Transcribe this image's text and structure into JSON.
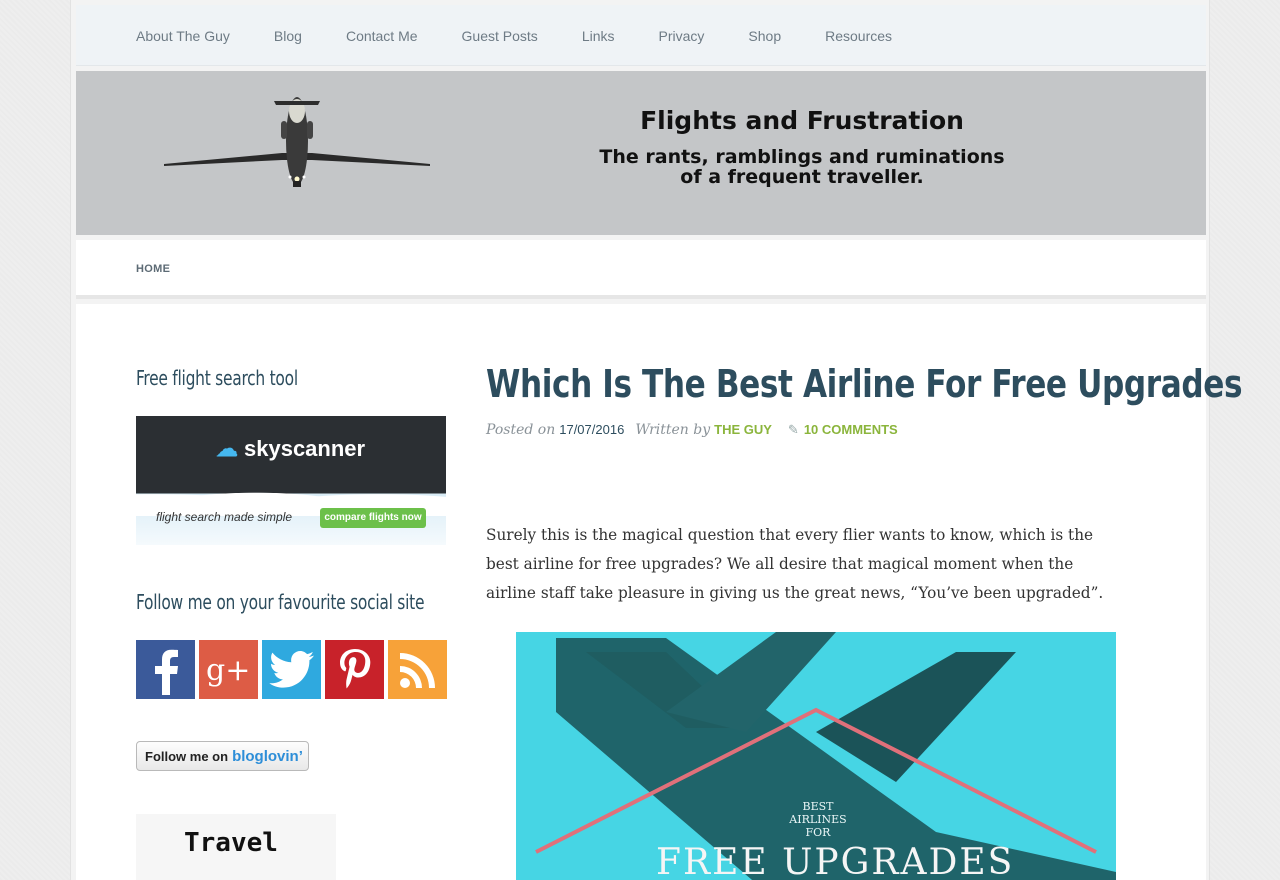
{
  "top_nav": {
    "items": [
      "About The Guy",
      "Blog",
      "Contact Me",
      "Guest Posts",
      "Links",
      "Privacy",
      "Shop",
      "Resources"
    ]
  },
  "header": {
    "site_title": "Flights and Frustration",
    "tagline_line1": "The rants, ramblings and ruminations",
    "tagline_line2": "of a frequent traveller."
  },
  "sub_nav": {
    "home_label": "HOME"
  },
  "sidebar": {
    "flight_search_title": "Free flight search tool",
    "skyscanner": {
      "logo_text": "skyscanner",
      "tagline": "flight search made simple",
      "button_label": "compare flights now"
    },
    "social_title": "Follow me on your favourite social site",
    "social_icons": [
      "facebook-icon",
      "google-plus-icon",
      "twitter-icon",
      "pinterest-icon",
      "rss-icon"
    ],
    "bloglovin": {
      "prefix": "Follow me on",
      "brand": "bloglovin’"
    },
    "travel_banner_text": "Travel"
  },
  "post": {
    "title": "Which Is The Best Airline For Free Upgrades",
    "posted_on_label": "Posted on",
    "date": "17/07/2016",
    "written_by_label": "Written by",
    "author": "THE GUY",
    "comments": "10 COMMENTS",
    "body": "Surely this is the magical question that every flier wants to know, which is the best airline for free upgrades? We all desire that magical moment when the airline staff take pleasure in giving us the great news, “You’ve been upgraded”.",
    "image_caption_small": "BEST AIRLINES FOR",
    "image_caption_large": "FREE UPGRADES"
  },
  "colors": {
    "title_color": "#2d4d5e",
    "link_green": "#8bb53c",
    "banner_gray": "#c4c6c8",
    "image_cyan": "#46d5e4"
  }
}
